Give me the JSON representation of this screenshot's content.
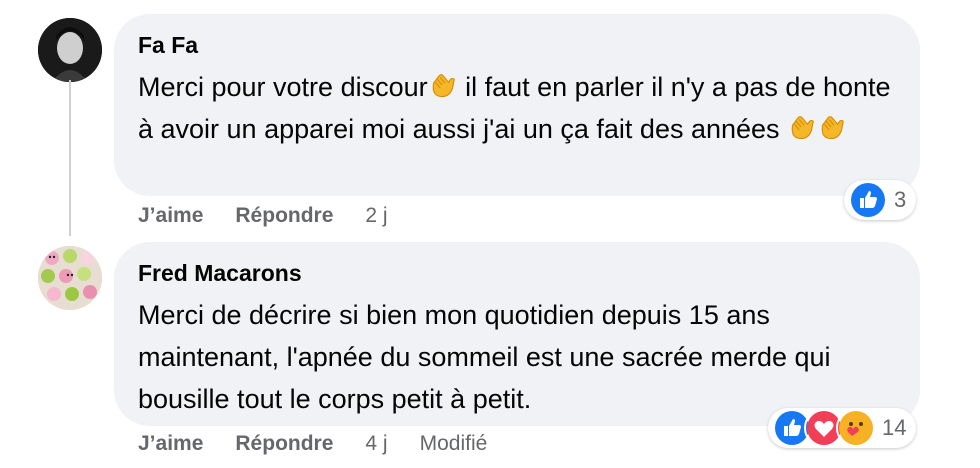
{
  "comments": [
    {
      "author": "Fa Fa",
      "text_part1": "Merci pour votre discour",
      "text_part2": " il faut en parler il n'y a pas de honte à avoir un apparei moi aussi j'ai un ça fait des années ",
      "reaction_count": "3",
      "like_label": "J’aime",
      "reply_label": "Répondre",
      "time": "2 j",
      "icons": [
        "avatar",
        "clapping-hands-icon",
        "like-reaction-icon"
      ]
    },
    {
      "author": "Fred Macarons",
      "text": "Merci de décrire si bien mon quotidien depuis 15 ans maintenant, l'apnée du sommeil est une sacrée merde qui bousille tout le corps petit à petit.",
      "reaction_count": "14",
      "like_label": "J’aime",
      "reply_label": "Répondre",
      "time": "4 j",
      "edited_label": "Modifié",
      "icons": [
        "avatar",
        "like-reaction-icon",
        "love-reaction-icon",
        "care-reaction-icon"
      ]
    }
  ],
  "colors": {
    "bubble": "#f0f2f5",
    "secondary_text": "#65676b",
    "like_blue": "#1877f2",
    "love_red": "#f33e58",
    "care_yellow": "#f7b125"
  }
}
